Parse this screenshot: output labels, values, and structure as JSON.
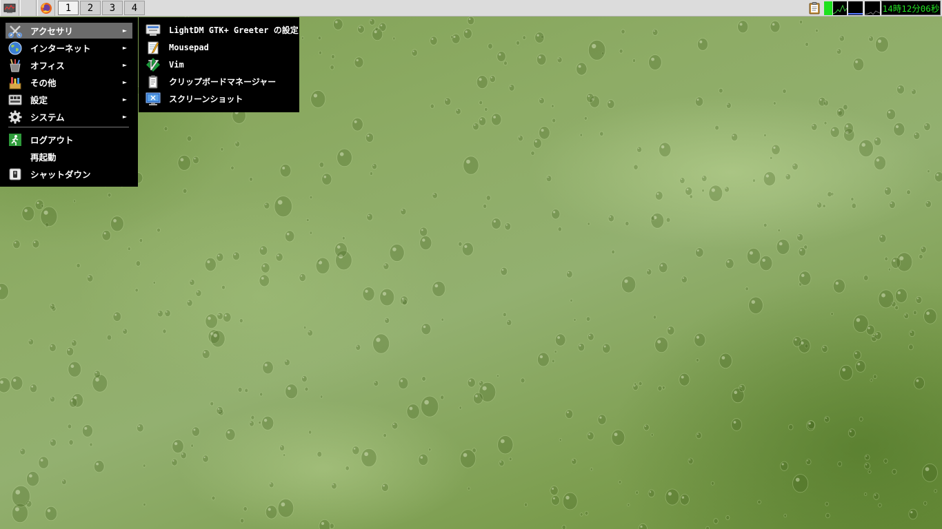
{
  "panel": {
    "launcher_icons": [
      "system-monitor-icon",
      "blank-launcher-icon",
      "firefox-icon"
    ],
    "workspaces": [
      {
        "label": "1",
        "active": true
      },
      {
        "label": "2",
        "active": false
      },
      {
        "label": "3",
        "active": false
      },
      {
        "label": "4",
        "active": false
      }
    ],
    "tray_icons": [
      "clipboard-icon",
      "cpu-meter-icon",
      "memory-meter-icon",
      "network-meter-icon",
      "swap-meter-icon"
    ],
    "clock": "14時12分06秒",
    "clock_color": "#22e022"
  },
  "main_menu": {
    "items": [
      {
        "label": "アクセサリ",
        "icon": "accessories-icon",
        "submenu": true,
        "active": true
      },
      {
        "label": "インターネット",
        "icon": "internet-globe-icon",
        "submenu": true,
        "active": false
      },
      {
        "label": "オフィス",
        "icon": "office-icon",
        "submenu": true,
        "active": false
      },
      {
        "label": "その他",
        "icon": "other-icon",
        "submenu": true,
        "active": false
      },
      {
        "label": "設定",
        "icon": "settings-icon",
        "submenu": true,
        "active": false
      },
      {
        "label": "システム",
        "icon": "system-gear-icon",
        "submenu": true,
        "active": false
      }
    ],
    "session_items": [
      {
        "label": "ログアウト",
        "icon": "logout-icon"
      },
      {
        "label": "再起動",
        "icon": ""
      },
      {
        "label": "シャットダウン",
        "icon": "shutdown-icon"
      }
    ],
    "arrow": "►"
  },
  "sub_menu": {
    "items": [
      {
        "label": "LightDM GTK+ Greeter の設定",
        "icon": "lightdm-settings-icon"
      },
      {
        "label": "Mousepad",
        "icon": "mousepad-icon"
      },
      {
        "label": "Vim",
        "icon": "vim-icon"
      },
      {
        "label": "クリップボードマネージャー",
        "icon": "clipboard-manager-icon"
      },
      {
        "label": "スクリーンショット",
        "icon": "screenshot-icon"
      }
    ]
  },
  "colors": {
    "menu_bg": "#000000",
    "menu_highlight": "#6b6b6b",
    "panel_bg": "#dcdcdc"
  }
}
